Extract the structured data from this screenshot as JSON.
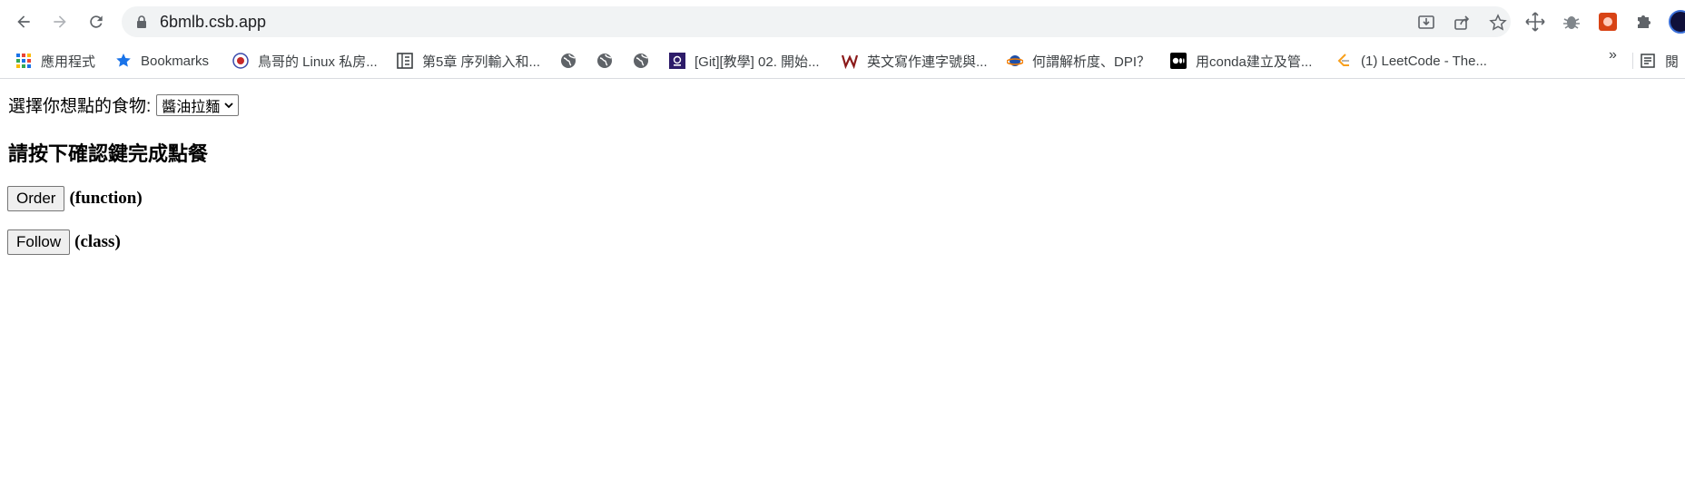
{
  "browser": {
    "url": "6bmlb.csb.app",
    "accent": "#1a73e8"
  },
  "bookmarks": [
    {
      "label": "應用程式",
      "icon": "apps-grid-icon"
    },
    {
      "label": "Bookmarks",
      "icon": "star-icon"
    },
    {
      "label": "鳥哥的 Linux 私房...",
      "icon": "site-logo-icon"
    },
    {
      "label": "第5章 序列輸入和...",
      "icon": "book-icon"
    },
    {
      "label": "",
      "icon": "globe-icon"
    },
    {
      "label": "",
      "icon": "globe-icon"
    },
    {
      "label": "",
      "icon": "globe-icon"
    },
    {
      "label": "[Git][教學] 02. 開始...",
      "icon": "purple-square-icon"
    },
    {
      "label": "英文寫作連字號與...",
      "icon": "w-logo-icon"
    },
    {
      "label": "何謂解析度、DPI？",
      "icon": "planet-icon"
    },
    {
      "label": "用conda建立及管...",
      "icon": "medium-icon"
    },
    {
      "label": "(1) LeetCode - The...",
      "icon": "leetcode-icon"
    }
  ],
  "bookmarks_more": "»",
  "bookmarks_trailing": "閱",
  "page": {
    "select_label": "選擇你想點的食物:",
    "select_value": "醬油拉麵",
    "heading": "請按下確認鍵完成點餐",
    "order_button": "Order",
    "order_note": "(function)",
    "follow_button": "Follow",
    "follow_note": "(class)"
  }
}
